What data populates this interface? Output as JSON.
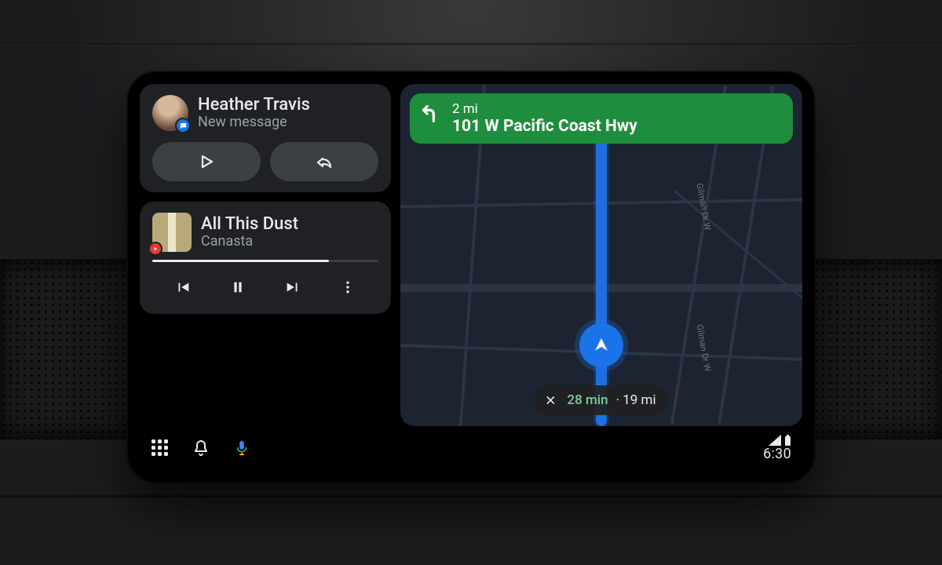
{
  "messages": {
    "sender": "Heather Travis",
    "subtitle": "New message"
  },
  "media": {
    "title": "All This Dust",
    "artist": "Canasta"
  },
  "navigation": {
    "distance": "2 mi",
    "road": "101 W Pacific Coast Hwy",
    "eta_time": "28 min",
    "eta_dist_sep": " · 19 mi",
    "street1": "Gilman Dr W",
    "street2": "Gilman Dr W"
  },
  "statusbar": {
    "clock": "6:30"
  }
}
